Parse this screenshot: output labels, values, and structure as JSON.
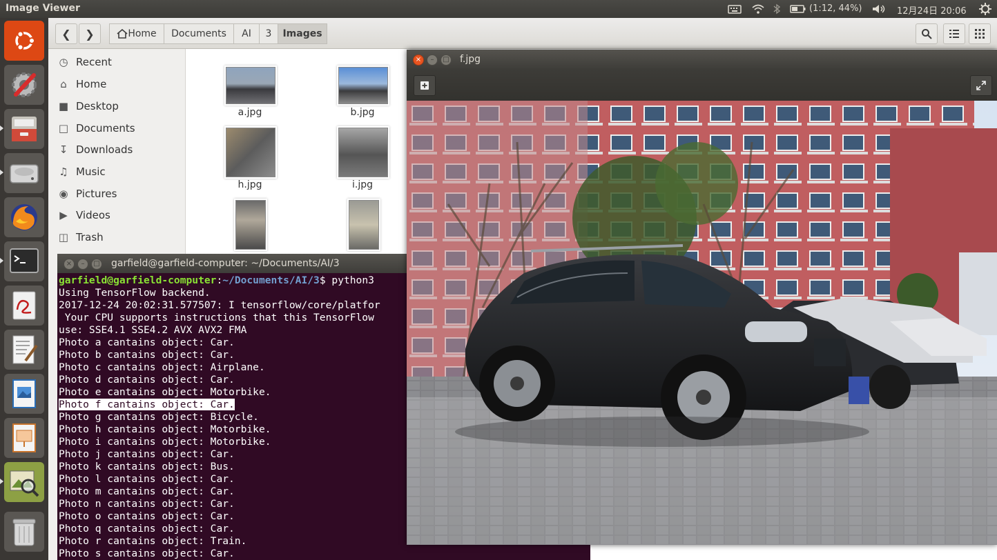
{
  "topbar": {
    "app_title": "Image Viewer",
    "battery": "(1:12, 44%)",
    "datetime": "12月24日 20:06"
  },
  "launcher": {
    "items": [
      "ubuntu-dash",
      "system-settings",
      "files-cabinet",
      "disk-drive",
      "firefox",
      "terminal",
      "document-viewer",
      "text-editor",
      "libreoffice-writer",
      "libreoffice-impress",
      "image-viewer",
      "trash"
    ]
  },
  "files": {
    "breadcrumb": [
      "Home",
      "Documents",
      "AI",
      "3",
      "Images"
    ],
    "sidebar": [
      {
        "icon": "clock-icon",
        "label": "Recent"
      },
      {
        "icon": "home-icon",
        "label": "Home"
      },
      {
        "icon": "folder-icon",
        "label": "Desktop"
      },
      {
        "icon": "document-icon",
        "label": "Documents"
      },
      {
        "icon": "download-icon",
        "label": "Downloads"
      },
      {
        "icon": "music-icon",
        "label": "Music"
      },
      {
        "icon": "camera-icon",
        "label": "Pictures"
      },
      {
        "icon": "video-icon",
        "label": "Videos"
      },
      {
        "icon": "trash-icon",
        "label": "Trash"
      }
    ],
    "thumbnails": [
      {
        "name": "a.jpg"
      },
      {
        "name": "b.jpg"
      },
      {
        "name": "h.jpg"
      },
      {
        "name": "i.jpg"
      },
      {
        "name": ""
      },
      {
        "name": ""
      }
    ]
  },
  "terminal": {
    "title": "garfield@garfield-computer: ~/Documents/AI/3",
    "prompt_user": "garfield@garfield-computer",
    "prompt_path": "~/Documents/AI/3",
    "prompt_cmd": "$ python3",
    "lines": [
      "Using TensorFlow backend.",
      "2017-12-24 20:02:31.577507: I tensorflow/core/platfor",
      " Your CPU supports instructions that this TensorFlow",
      "use: SSE4.1 SSE4.2 AVX AVX2 FMA",
      "Photo a cantains object: Car.",
      "Photo b cantains object: Car.",
      "Photo c cantains object: Airplane.",
      "Photo d cantains object: Car.",
      "Photo e cantains object: Motorbike.",
      "Photo f cantains object: Car.",
      "Photo g cantains object: Bicycle.",
      "Photo h cantains object: Motorbike.",
      "Photo i cantains object: Motorbike.",
      "Photo j cantains object: Car.",
      "Photo k cantains object: Bus.",
      "Photo l cantains object: Car.",
      "Photo m cantains object: Car.",
      "Photo n cantains object: Car.",
      "Photo o cantains object: Car.",
      "Photo q cantains object: Car.",
      "Photo r cantains object: Train.",
      "Photo s cantains object: Car."
    ]
  },
  "viewer": {
    "title": "f.jpg"
  }
}
